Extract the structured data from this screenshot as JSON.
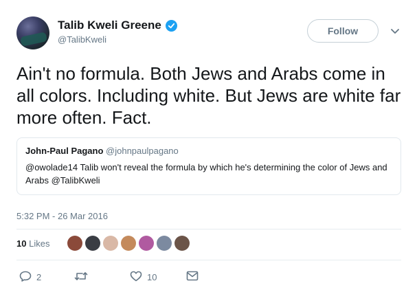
{
  "author": {
    "name": "Talib Kweli Greene",
    "handle": "@TalibKweli"
  },
  "follow_label": "Follow",
  "tweet_text": "Ain't no formula. Both Jews and Arabs come in all colors. Including white. But Jews are white far more often. Fact.",
  "quoted": {
    "name": "John-Paul Pagano",
    "handle": "@johnpaulpagano",
    "text": "@owolade14 Talib won't reveal the formula by which he's determining the color of Jews and Arabs @TalibKweli"
  },
  "timestamp": "5:32 PM - 26 Mar 2016",
  "likes": {
    "count": "10",
    "label": "Likes"
  },
  "liker_avatar_colors": [
    "#8b4a3a",
    "#3a3d44",
    "#d9b8a6",
    "#c48a5c",
    "#b05aa0",
    "#7c8aa0",
    "#6b5448"
  ],
  "actions": {
    "replies": "2",
    "retweets": "",
    "likes": "10"
  },
  "colors": {
    "accent": "#1da1f2",
    "secondary_text": "#657786"
  }
}
